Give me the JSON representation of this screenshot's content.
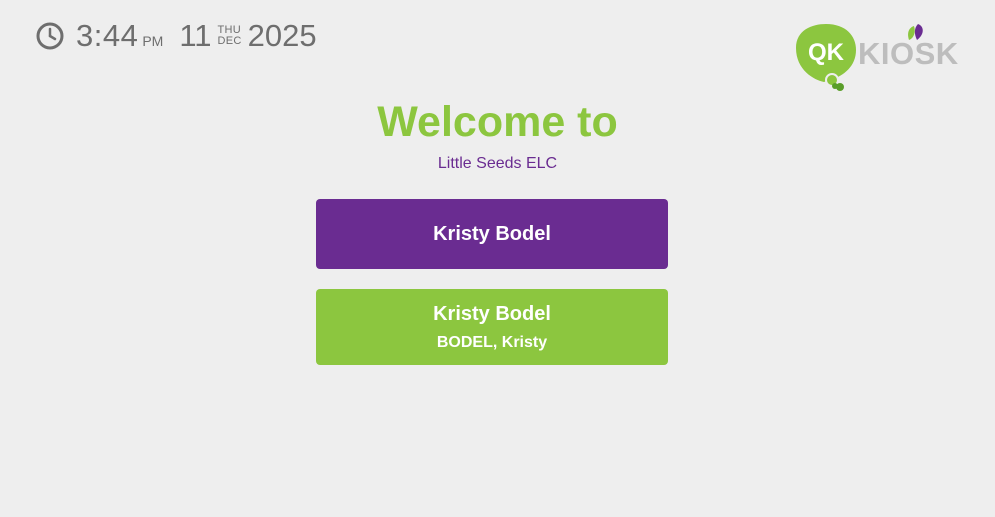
{
  "clock": {
    "time": "3:44",
    "ampm": "PM",
    "day": "11",
    "dow": "THU",
    "month": "DEC",
    "year": "2025",
    "icon": "clock-icon"
  },
  "logo": {
    "badge_text": "QK",
    "word_text": "KIOSK",
    "colors": {
      "green": "#8cc63f",
      "purple": "#6a2c91",
      "gray": "#bdbdbd"
    }
  },
  "welcome": {
    "title": "Welcome to",
    "org_name": "Little Seeds ELC"
  },
  "buttons": [
    {
      "title": "Kristy Bodel",
      "color": "#6a2c91"
    },
    {
      "title": "Kristy Bodel",
      "subtitle": "BODEL, Kristy",
      "color": "#8cc63f"
    }
  ]
}
